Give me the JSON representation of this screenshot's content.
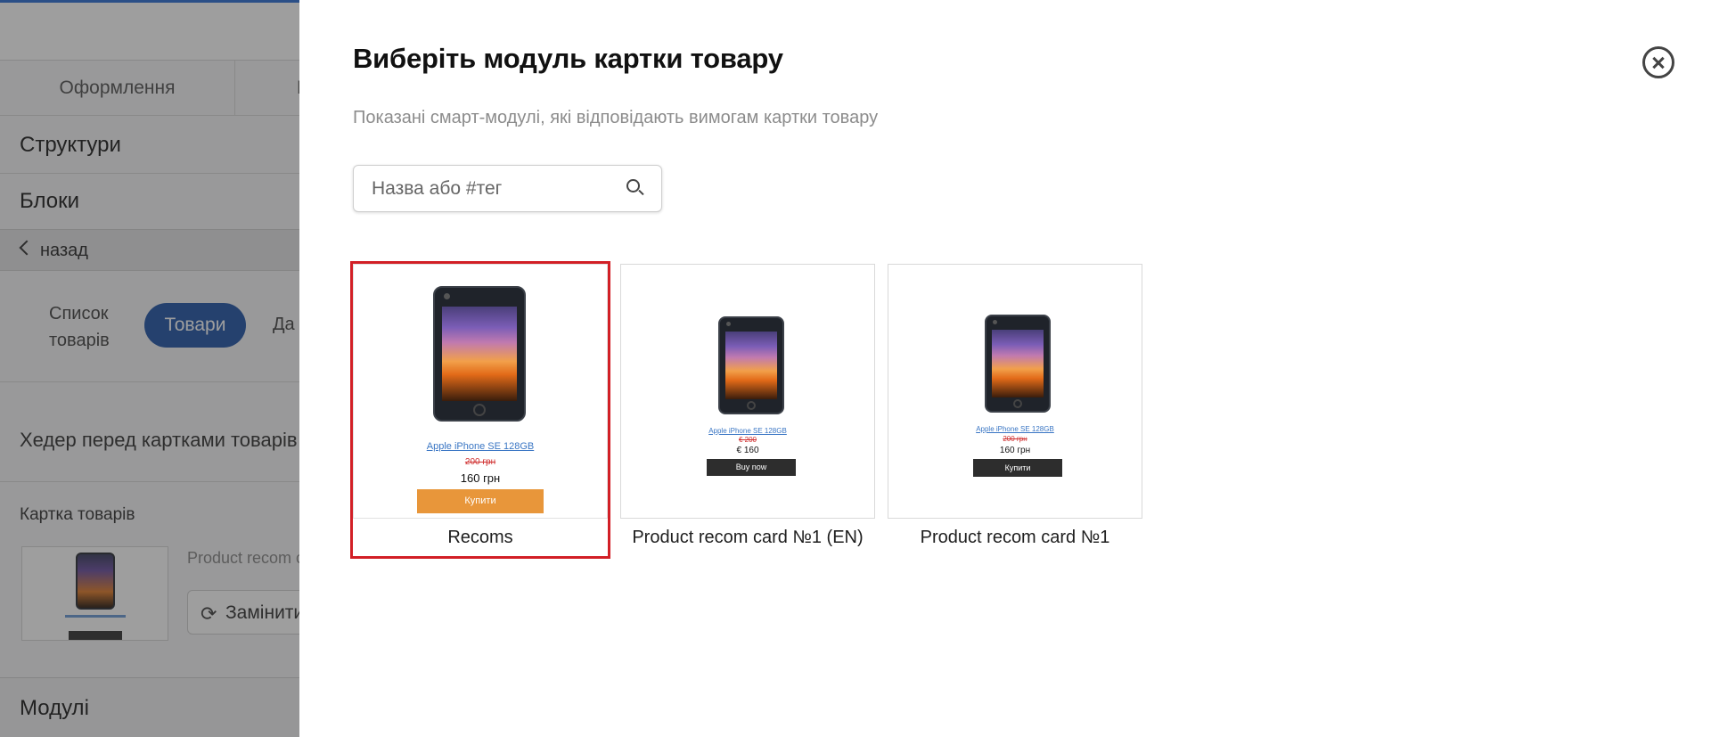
{
  "background": {
    "tabs": [
      "Оформлення",
      "Н"
    ],
    "sections": {
      "structures": "Структури",
      "blocks": "Блоки"
    },
    "back_label": "назад",
    "subtabs": [
      "Список товарів",
      "Товари",
      "Да"
    ],
    "header_before_cards": "Хедер перед картками товарів",
    "product_card_label": "Картка товарів",
    "current_module": "Product recom c",
    "replace_label": "Замінити",
    "modules_label": "Модулі"
  },
  "modal": {
    "title": "Виберіть модуль картки товару",
    "subtitle": "Показані смарт-модулі, які відповідають вимогам картки товару",
    "search_placeholder": "Назва або #тег",
    "cards": [
      {
        "label": "Recoms",
        "selected": true,
        "product_name": "Apple iPhone SE 128GB",
        "old_price": "200 грн",
        "new_price": "160 грн",
        "button": "Купити",
        "button_color": "#e8963a"
      },
      {
        "label": "Product recom card №1 (EN)",
        "selected": false,
        "product_name": "Apple iPhone SE 128GB",
        "old_price": "€ 200",
        "new_price": "€ 160",
        "button": "Buy now",
        "button_color": "#2d2d2d"
      },
      {
        "label": "Product recom card №1",
        "selected": false,
        "product_name": "Apple iPhone SE 128GB",
        "old_price": "200 грн",
        "new_price": "160 грн",
        "button": "Купити",
        "button_color": "#2d2d2d"
      }
    ]
  },
  "colors": {
    "selected_outline": "#d21f26",
    "pill_active": "#2457a8",
    "accent_topline": "#2f6fd6"
  }
}
